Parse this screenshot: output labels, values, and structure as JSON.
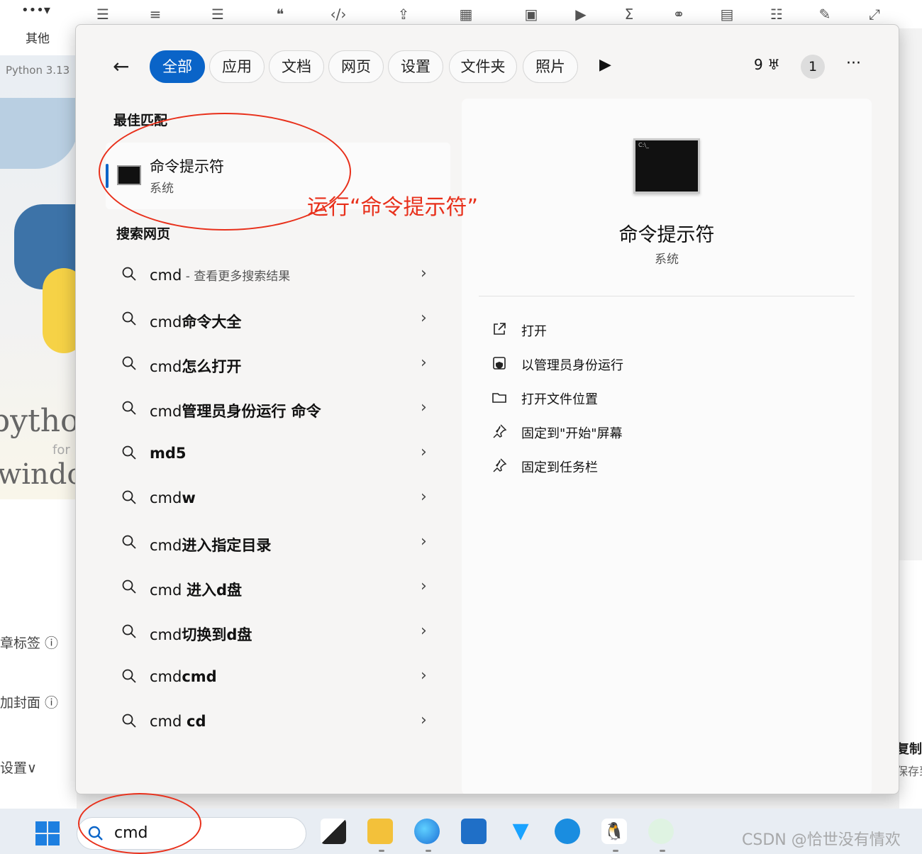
{
  "background": {
    "other_label": "其他",
    "python_version": "Python 3.13",
    "python_word": "pythor",
    "python_for": "for",
    "windows_word": "windov",
    "left_labels": [
      "章标签 ⓘ",
      "加封面 ⓘ",
      "设置∨"
    ],
    "right_labels": [
      "复制到",
      "保存到"
    ]
  },
  "search_panel": {
    "tabs": [
      "全部",
      "应用",
      "文档",
      "网页",
      "设置",
      "文件夹",
      "照片"
    ],
    "points": "9",
    "avatar_initial": "1",
    "best_match": {
      "section_title": "最佳匹配",
      "name": "命令提示符",
      "subtitle": "系统"
    },
    "web_search": {
      "section_title": "搜索网页",
      "results": [
        {
          "prefix": "cmd",
          "bold": "",
          "hint": " - 查看更多搜索结果"
        },
        {
          "prefix": "cmd",
          "bold": "命令大全",
          "hint": ""
        },
        {
          "prefix": "cmd",
          "bold": "怎么打开",
          "hint": ""
        },
        {
          "prefix": "cmd",
          "bold": "管理员身份运行 命令",
          "hint": ""
        },
        {
          "prefix": "",
          "bold": "md5",
          "hint": ""
        },
        {
          "prefix": "cmd",
          "bold": "w",
          "hint": ""
        },
        {
          "prefix": "cmd",
          "bold": "进入指定目录",
          "hint": ""
        },
        {
          "prefix": "cmd ",
          "bold": "进入d盘",
          "hint": ""
        },
        {
          "prefix": "cmd",
          "bold": "切换到d盘",
          "hint": ""
        },
        {
          "prefix": "cmd",
          "bold": "cmd",
          "hint": ""
        },
        {
          "prefix": "cmd ",
          "bold": "cd",
          "hint": ""
        }
      ]
    },
    "detail": {
      "name": "命令提示符",
      "subtitle": "系统",
      "icon_caption": "C:\\_",
      "actions": [
        "打开",
        "以管理员身份运行",
        "打开文件位置",
        "固定到\"开始\"屏幕",
        "固定到任务栏"
      ]
    },
    "annotation": "运行“命令提示符”"
  },
  "taskbar": {
    "search_value": "cmd",
    "watermark": "CSDN @恰世没有情欢"
  },
  "colors": {
    "accent": "#0a64c8",
    "annotation": "#e8301b"
  }
}
